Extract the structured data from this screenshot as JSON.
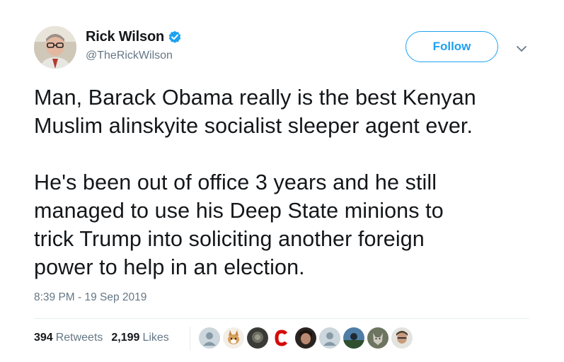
{
  "author": {
    "name": "Rick Wilson",
    "handle": "@TheRickWilson",
    "verified": true
  },
  "follow_label": "Follow",
  "tweet": {
    "paragraphs": [
      "Man, Barack Obama really is the best  Kenyan\nMuslim alinskyite socialist sleeper agent ever.",
      "He's been out of office 3 years and he still\nmanaged to use his Deep State minions to\ntrick Trump  into soliciting another foreign\npower to help in an election."
    ],
    "timestamp": "8:39 PM - 19 Sep 2019"
  },
  "stats": {
    "retweets_count": "394",
    "retweets_label": "Retweets",
    "likes_count": "2,199",
    "likes_label": "Likes"
  },
  "likers": [
    {
      "icon": "default-avatar"
    },
    {
      "icon": "dog-avatar"
    },
    {
      "icon": "photo-avatar"
    },
    {
      "icon": "c-logo-avatar"
    },
    {
      "icon": "photo-avatar"
    },
    {
      "icon": "default-avatar"
    },
    {
      "icon": "photo-avatar"
    },
    {
      "icon": "wolf-avatar"
    },
    {
      "icon": "photo-avatar"
    }
  ],
  "colors": {
    "accent": "#1da1f2",
    "text": "#14171a",
    "secondary": "#657786",
    "divider": "#e6ecf0"
  }
}
